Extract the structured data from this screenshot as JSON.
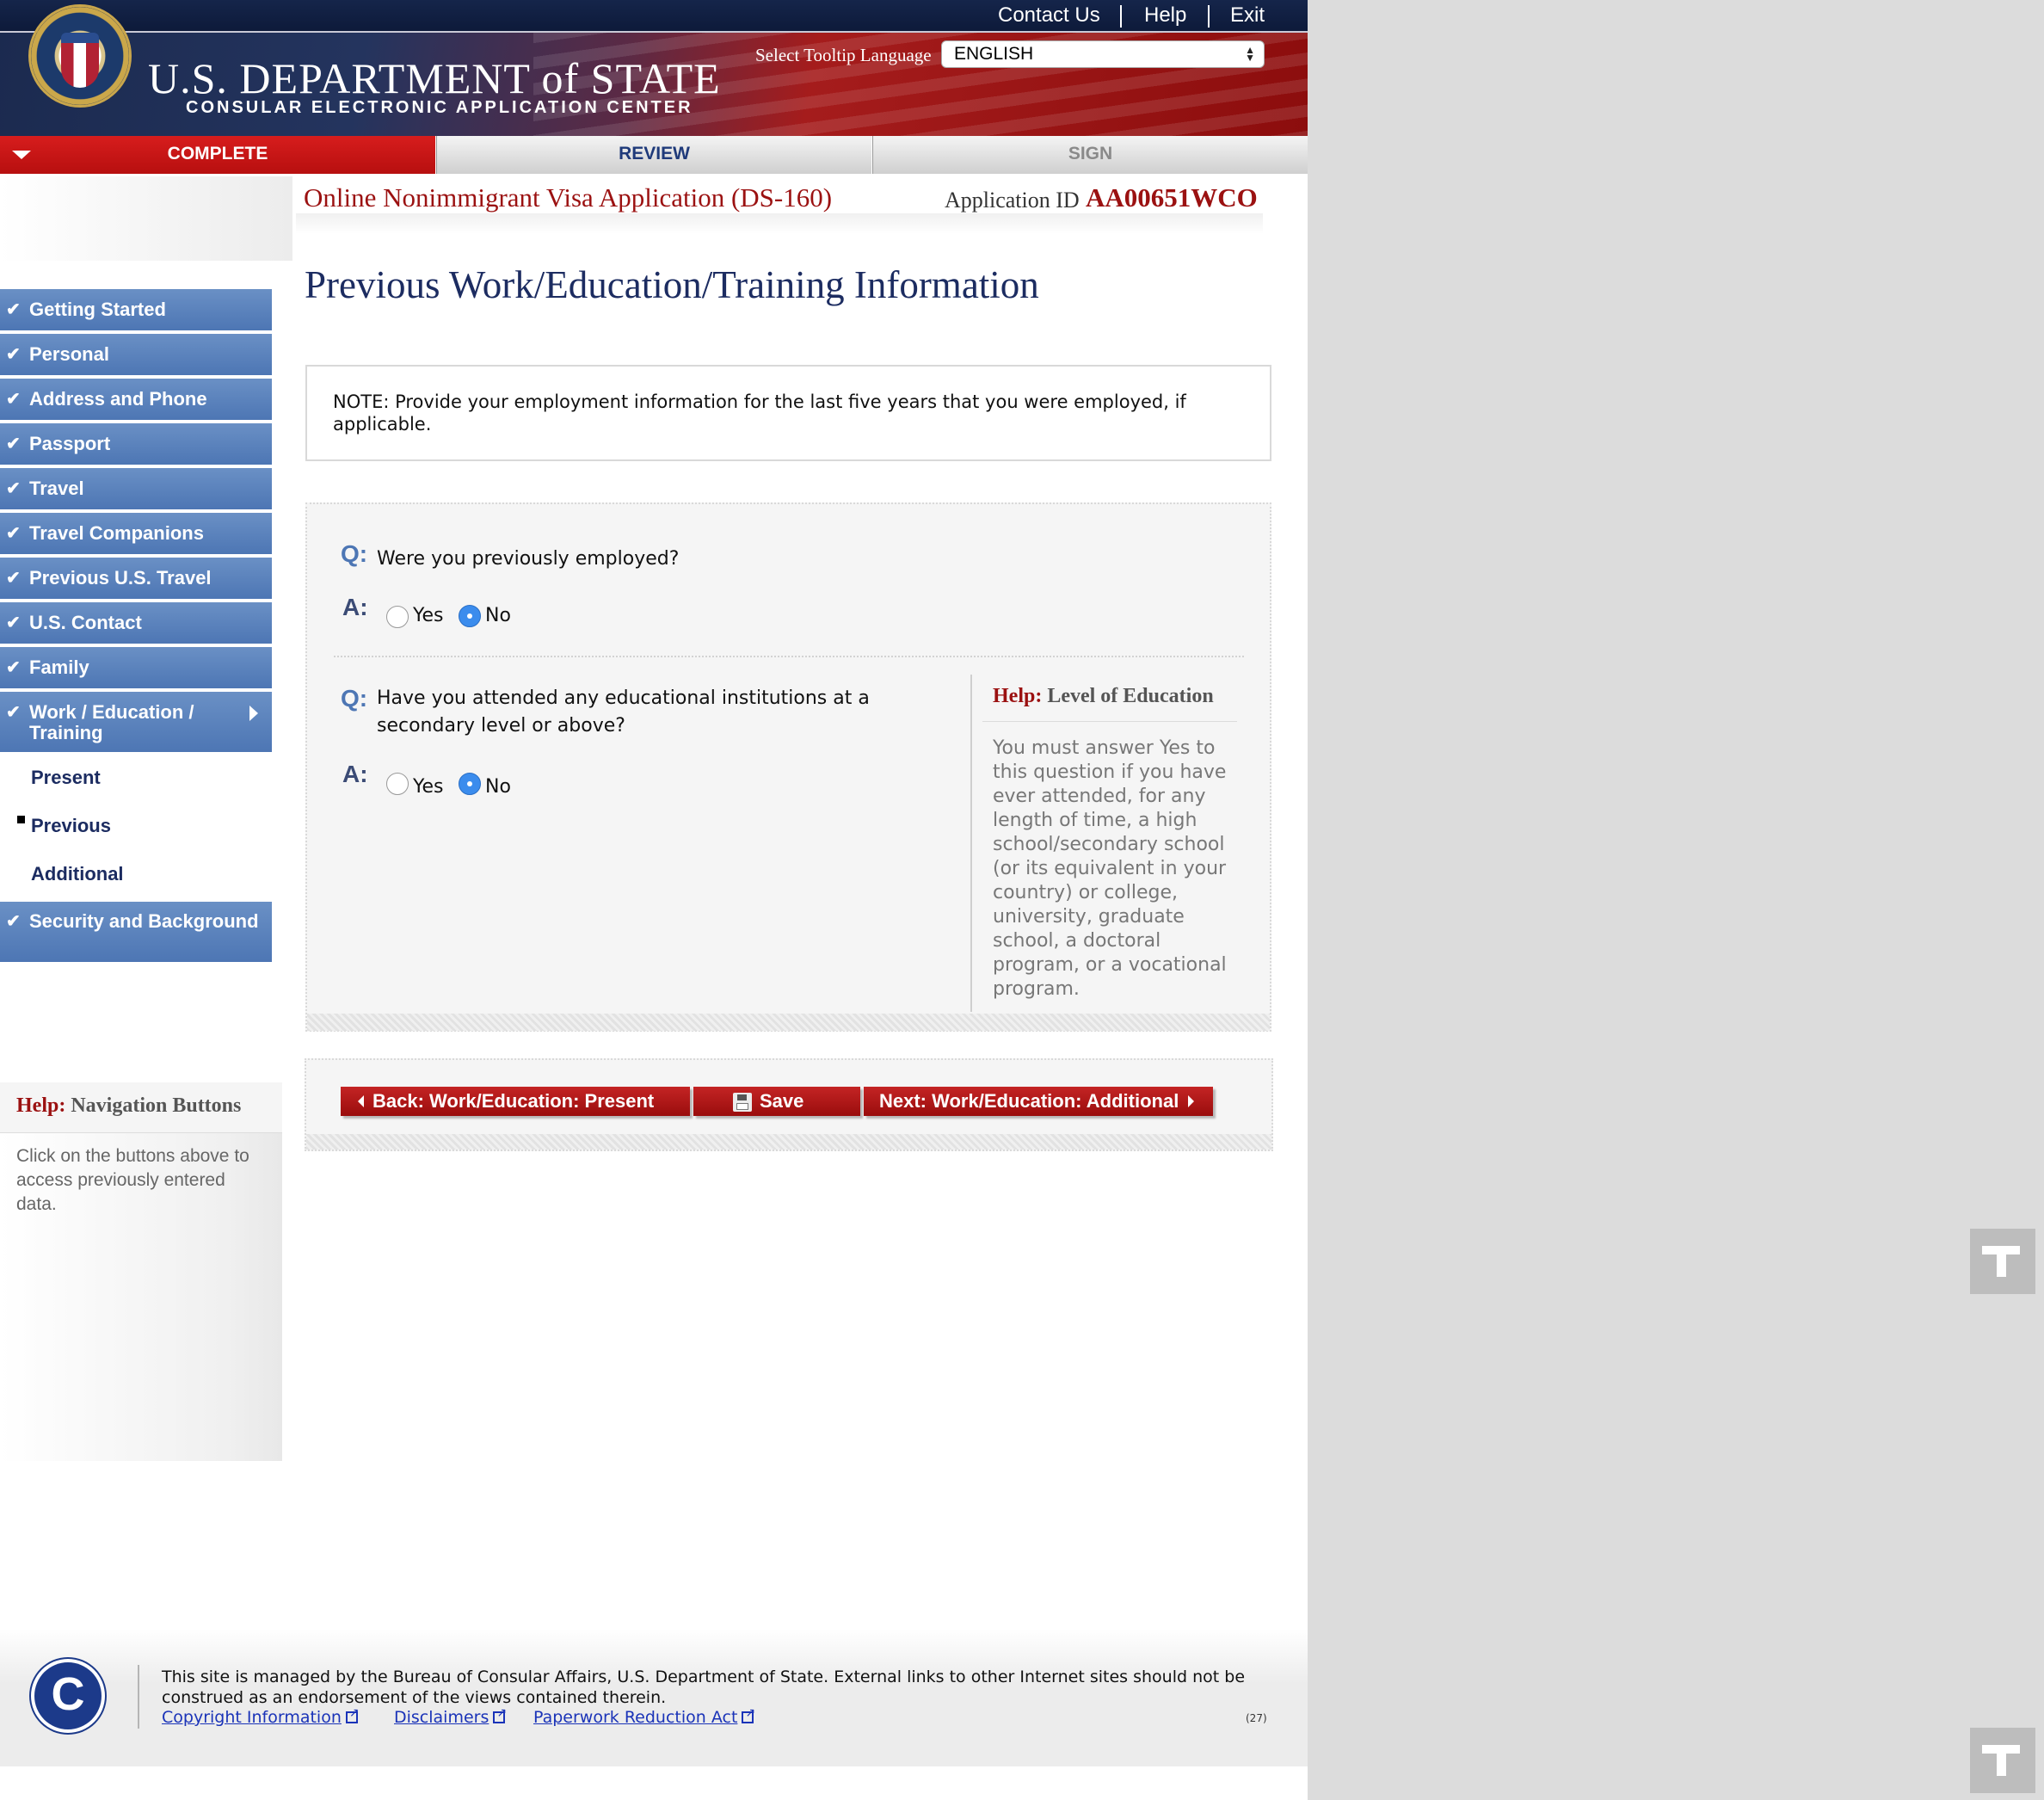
{
  "header": {
    "top_links": [
      "Contact Us",
      "Help",
      "Exit"
    ],
    "department": "U.S. DEPARTMENT of STATE",
    "subtitle": "CONSULAR ELECTRONIC APPLICATION CENTER",
    "tooltip_label": "Select Tooltip Language",
    "tooltip_language": "ENGLISH"
  },
  "steps": {
    "complete": "COMPLETE",
    "review": "REVIEW",
    "sign": "SIGN"
  },
  "application": {
    "title": "Online Nonimmigrant Visa Application (DS-160)",
    "id_label": "Application ID",
    "id": "AA00651WCO"
  },
  "sidebar": {
    "items": [
      {
        "label": "Getting Started"
      },
      {
        "label": "Personal"
      },
      {
        "label": "Address and Phone"
      },
      {
        "label": "Passport"
      },
      {
        "label": "Travel"
      },
      {
        "label": "Travel Companions"
      },
      {
        "label": "Previous U.S. Travel"
      },
      {
        "label": "U.S. Contact"
      },
      {
        "label": "Family"
      },
      {
        "label": "Work / Education / Training"
      },
      {
        "label": "Security and Background"
      }
    ],
    "subitems": [
      {
        "label": "Present"
      },
      {
        "label": "Previous"
      },
      {
        "label": "Additional"
      }
    ],
    "help": {
      "prefix": "Help:",
      "title": "Navigation Buttons",
      "text": "Click on the buttons above to access previously entered data."
    }
  },
  "main": {
    "page_title": "Previous Work/Education/Training Information",
    "note": "NOTE: Provide your employment information for the last five years that you were employed, if applicable.",
    "q_label": "Q:",
    "a_label": "A:",
    "questions": [
      {
        "text": "Were you previously employed?",
        "options": [
          "Yes",
          "No"
        ],
        "selected": "No"
      },
      {
        "text": "Have you attended any educational institutions at a secondary level or above?",
        "options": [
          "Yes",
          "No"
        ],
        "selected": "No"
      }
    ],
    "help": {
      "prefix": "Help:",
      "title": "Level of Education",
      "text": "You must answer Yes to this question if you have ever attended, for any length of time, a high school/secondary school (or its equivalent in your country) or college, university, graduate school, a doctoral program, or a vocational program."
    }
  },
  "buttons": {
    "back": "Back: Work/Education: Present",
    "save": "Save",
    "next": "Next: Work/Education: Additional"
  },
  "footer": {
    "logo_letter": "C",
    "text": "This site is managed by the Bureau of Consular Affairs, U.S. Department of State. External links to other Internet sites should not be construed as an endorsement of the views contained therein.",
    "links": [
      "Copyright Information",
      "Disclaimers",
      "Paperwork Reduction Act"
    ],
    "page_number": "(27)"
  },
  "colors": {
    "brand_red": "#9b1111",
    "nav_blue": "#4d76b4",
    "title_navy": "#1c2c61",
    "radio_selected": "#3b8ced"
  }
}
